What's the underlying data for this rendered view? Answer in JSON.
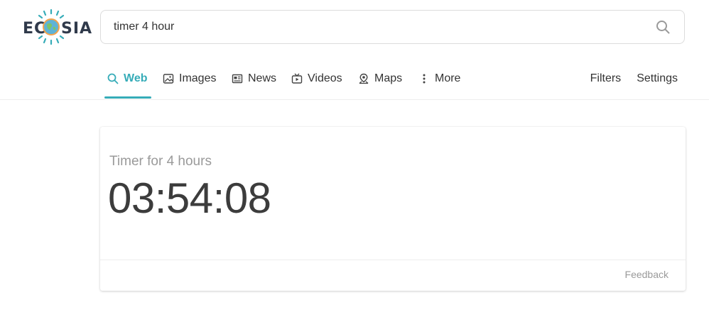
{
  "logo": {
    "text": "ECOSIA",
    "colors": {
      "text": "#303a4b",
      "rays": "#36acb8",
      "globe": "#5fb3d6",
      "land": "#7cc36b",
      "ring": "#f4a34c"
    }
  },
  "search": {
    "value": "timer 4 hour",
    "icon": "search-icon"
  },
  "tabs": [
    {
      "label": "Web",
      "icon": "search-icon",
      "active": true
    },
    {
      "label": "Images",
      "icon": "image-icon",
      "active": false
    },
    {
      "label": "News",
      "icon": "newspaper-icon",
      "active": false
    },
    {
      "label": "Videos",
      "icon": "video-icon",
      "active": false
    },
    {
      "label": "Maps",
      "icon": "map-pin-icon",
      "active": false
    },
    {
      "label": "More",
      "icon": "more-vertical-icon",
      "active": false
    }
  ],
  "header_links": {
    "filters": "Filters",
    "settings": "Settings"
  },
  "timer": {
    "label": "Timer for 4 hours",
    "value": "03:54:08"
  },
  "card": {
    "feedback": "Feedback"
  },
  "colors": {
    "accent": "#36acb8",
    "text": "#333333",
    "muted": "#9a9a9a"
  }
}
